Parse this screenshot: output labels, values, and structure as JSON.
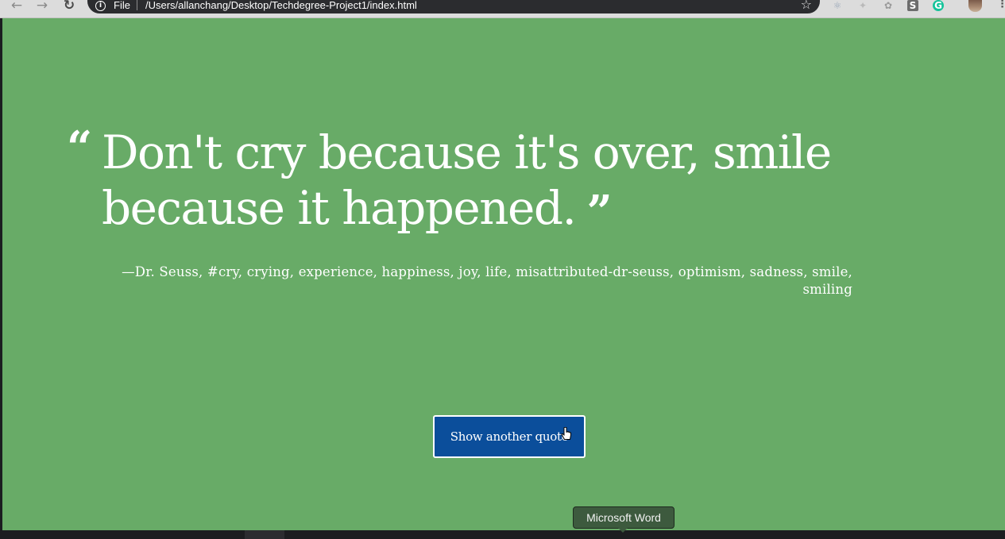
{
  "browser": {
    "back_icon": "arrow-left-icon",
    "forward_icon": "arrow-right-icon",
    "reload_icon": "reload-icon",
    "scheme_label": "File",
    "url": "/Users/allanchang/Desktop/Techdegree-Project1/index.html",
    "bookmark_icon": "star-icon",
    "extensions": [
      "react-devtools-icon",
      "extension-icon",
      "extension-icon",
      "s-extension-icon",
      "grammarly-icon"
    ],
    "extension_s_label": "S",
    "extension_grammarly_label": "G"
  },
  "page": {
    "background_color": "#68ab67",
    "quote_open": "“",
    "quote_text": "Don't cry because it's over, smile because it happened.",
    "quote_close": "”",
    "source": "—Dr. Seuss, #cry, crying, experience, happiness, joy, life, misattributed-dr-seuss, optimism, sadness, smile, smiling",
    "button_label": "Show another quote",
    "button_color": "#0b4e9b"
  },
  "os": {
    "tooltip": "Microsoft Word"
  }
}
